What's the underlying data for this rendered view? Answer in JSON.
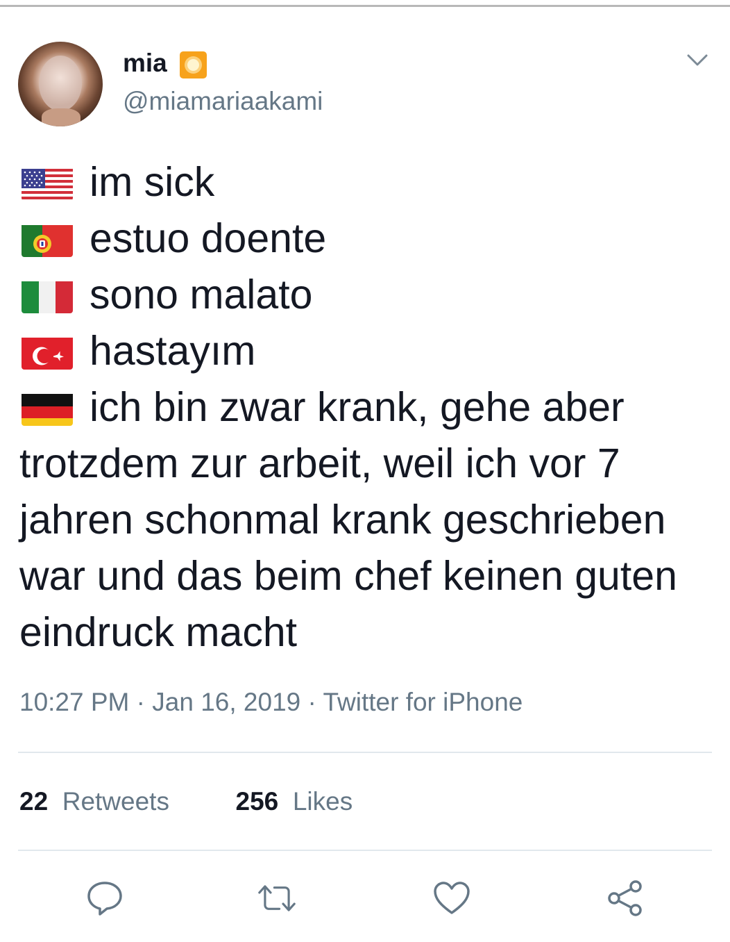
{
  "user": {
    "name": "mia",
    "handle": "@miamariaakami",
    "badge_icon": "sun-emoji-icon"
  },
  "tweet": {
    "lines": [
      {
        "flag": "us-flag-icon",
        "text": "im sick"
      },
      {
        "flag": "portugal-flag-icon",
        "text": "estuo doente"
      },
      {
        "flag": "italy-flag-icon",
        "text": "sono malato"
      },
      {
        "flag": "turkey-flag-icon",
        "text": "hastayım"
      },
      {
        "flag": "germany-flag-icon",
        "text": "ich bin zwar krank, gehe aber"
      }
    ],
    "continuation": [
      "trotzdem zur arbeit, weil ich vor 7",
      "jahren schonmal krank geschrieben",
      "war und das beim chef keinen guten",
      "eindruck macht"
    ]
  },
  "meta": {
    "time": "10:27 PM",
    "sep1": " · ",
    "date": "Jan 16, 2019",
    "sep2": " · ",
    "source": "Twitter for iPhone"
  },
  "stats": {
    "retweets_count": "22",
    "retweets_label": "Retweets",
    "likes_count": "256",
    "likes_label": "Likes"
  },
  "actions": [
    "reply-icon",
    "retweet-icon",
    "like-icon",
    "share-icon"
  ],
  "colors": {
    "text": "#141823",
    "secondary": "#657786",
    "divider": "#e1e8ed"
  }
}
